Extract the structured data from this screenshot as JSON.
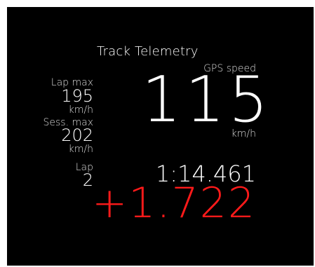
{
  "title": "Track Telemetry",
  "gps": {
    "label": "GPS speed",
    "value": "115",
    "unit": "km/h"
  },
  "lap_max": {
    "label": "Lap max",
    "value": "195",
    "unit": "km/h"
  },
  "session_max": {
    "label": "Sess. max",
    "value": "202",
    "unit": "km/h"
  },
  "lap": {
    "label": "Lap",
    "value": "2"
  },
  "lap_time": "1:14.461",
  "delta": {
    "value": "+1.722",
    "color": "#ff1a1a"
  },
  "colors": {
    "background": "#000000",
    "text": "#ffffff",
    "secondary": "#dcdcdc"
  }
}
